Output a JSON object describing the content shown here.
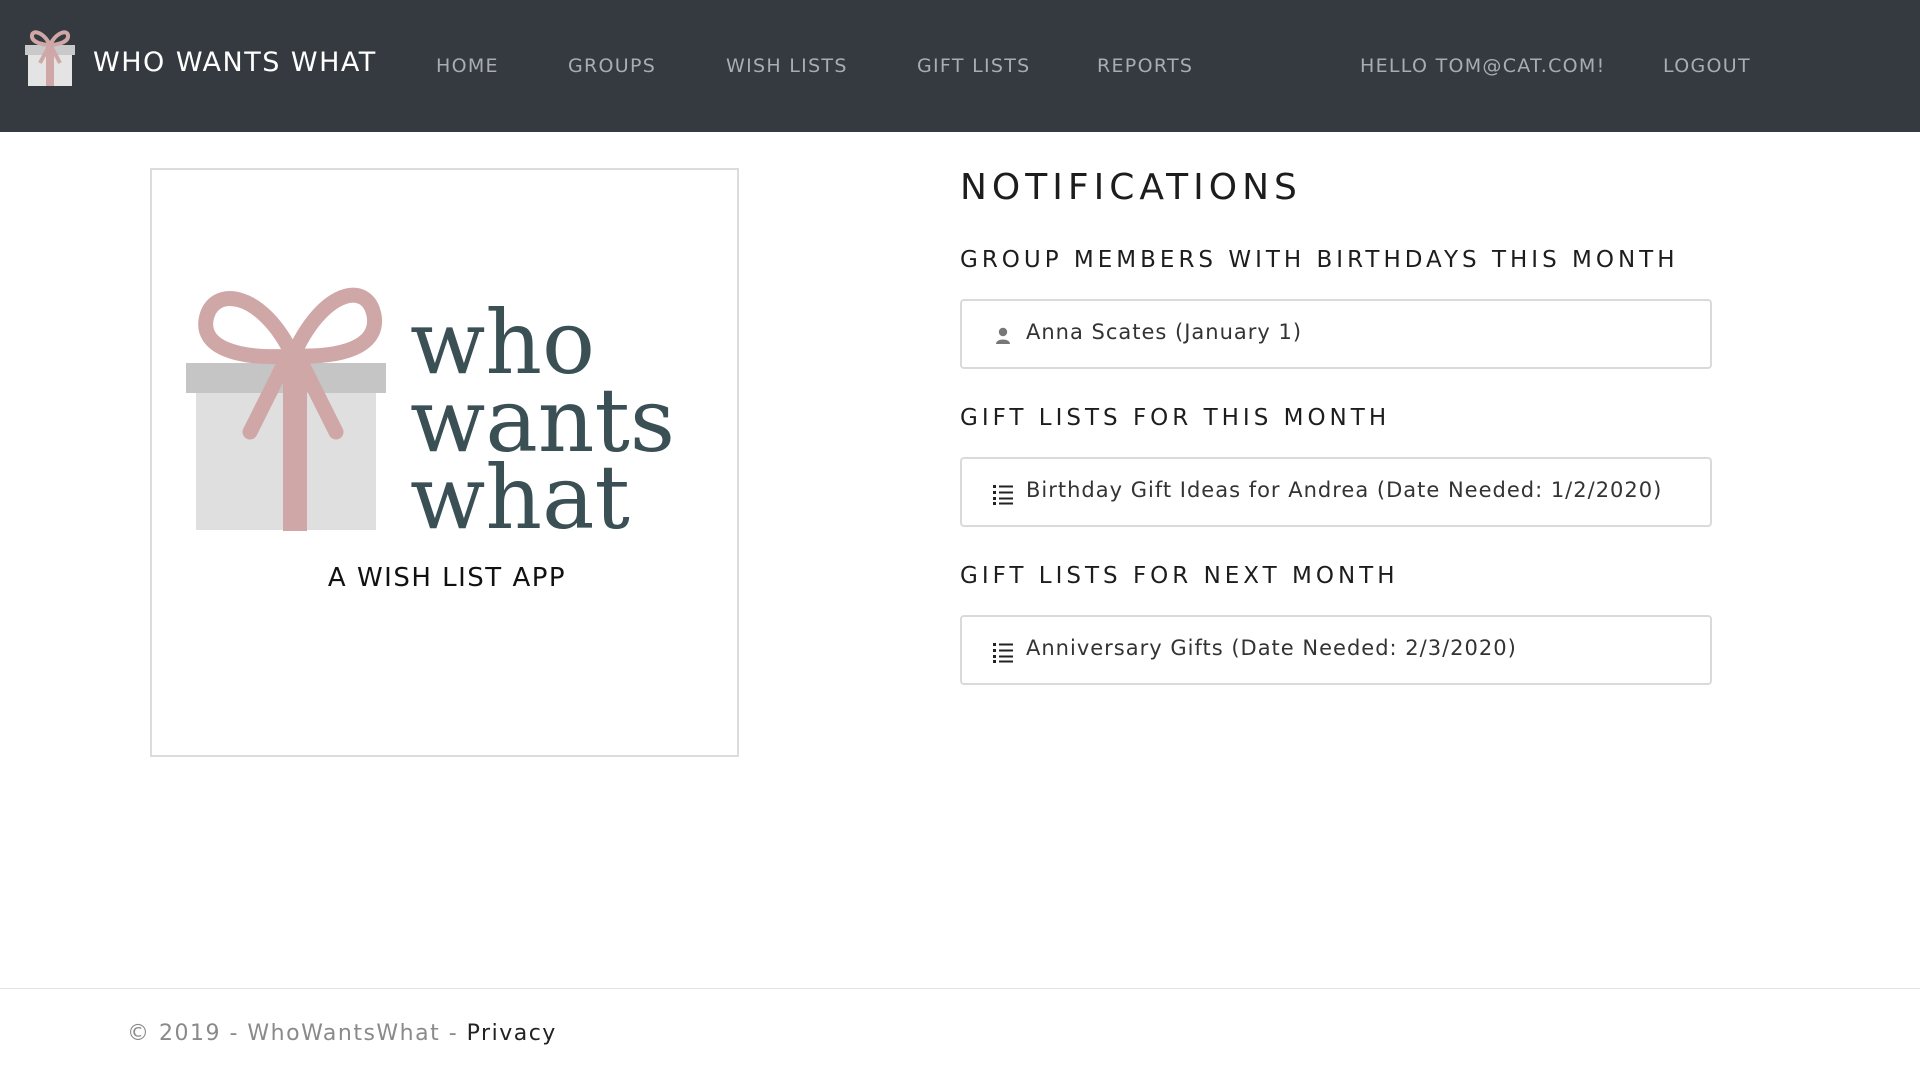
{
  "nav": {
    "brand": "WHO WANTS WHAT",
    "brand_icon": "gift-icon",
    "links": [
      {
        "label": "HOME"
      },
      {
        "label": "GROUPS"
      },
      {
        "label": "WISH LISTS"
      },
      {
        "label": "GIFT LISTS"
      },
      {
        "label": "REPORTS"
      }
    ],
    "greeting": "HELLO TOM@CAT.COM!",
    "logout": "LOGOUT"
  },
  "logo": {
    "word1": "who",
    "word2": "wants",
    "word3": "what",
    "tagline": "A WISH LIST APP",
    "colors": {
      "ribbon": "#d0a7a7",
      "box": "#dfdfdf",
      "lid": "#c5c5c5",
      "text": "#3a5055"
    }
  },
  "notifications": {
    "title": "NOTIFICATIONS",
    "birthdays": {
      "heading": "GROUP MEMBERS WITH BIRTHDAYS THIS MONTH",
      "items": [
        {
          "text": "Anna Scates (January 1)",
          "icon": "user-icon"
        }
      ]
    },
    "this_month": {
      "heading": "GIFT LISTS FOR THIS MONTH",
      "items": [
        {
          "text": "Birthday Gift Ideas for Andrea (Date Needed: 1/2/2020)",
          "icon": "list-icon"
        }
      ]
    },
    "next_month": {
      "heading": "GIFT LISTS FOR NEXT MONTH",
      "items": [
        {
          "text": "Anniversary Gifts (Date Needed: 2/3/2020)",
          "icon": "list-icon"
        }
      ]
    }
  },
  "footer": {
    "copyright": "© 2019 - WhoWantsWhat - ",
    "privacy": "Privacy"
  }
}
